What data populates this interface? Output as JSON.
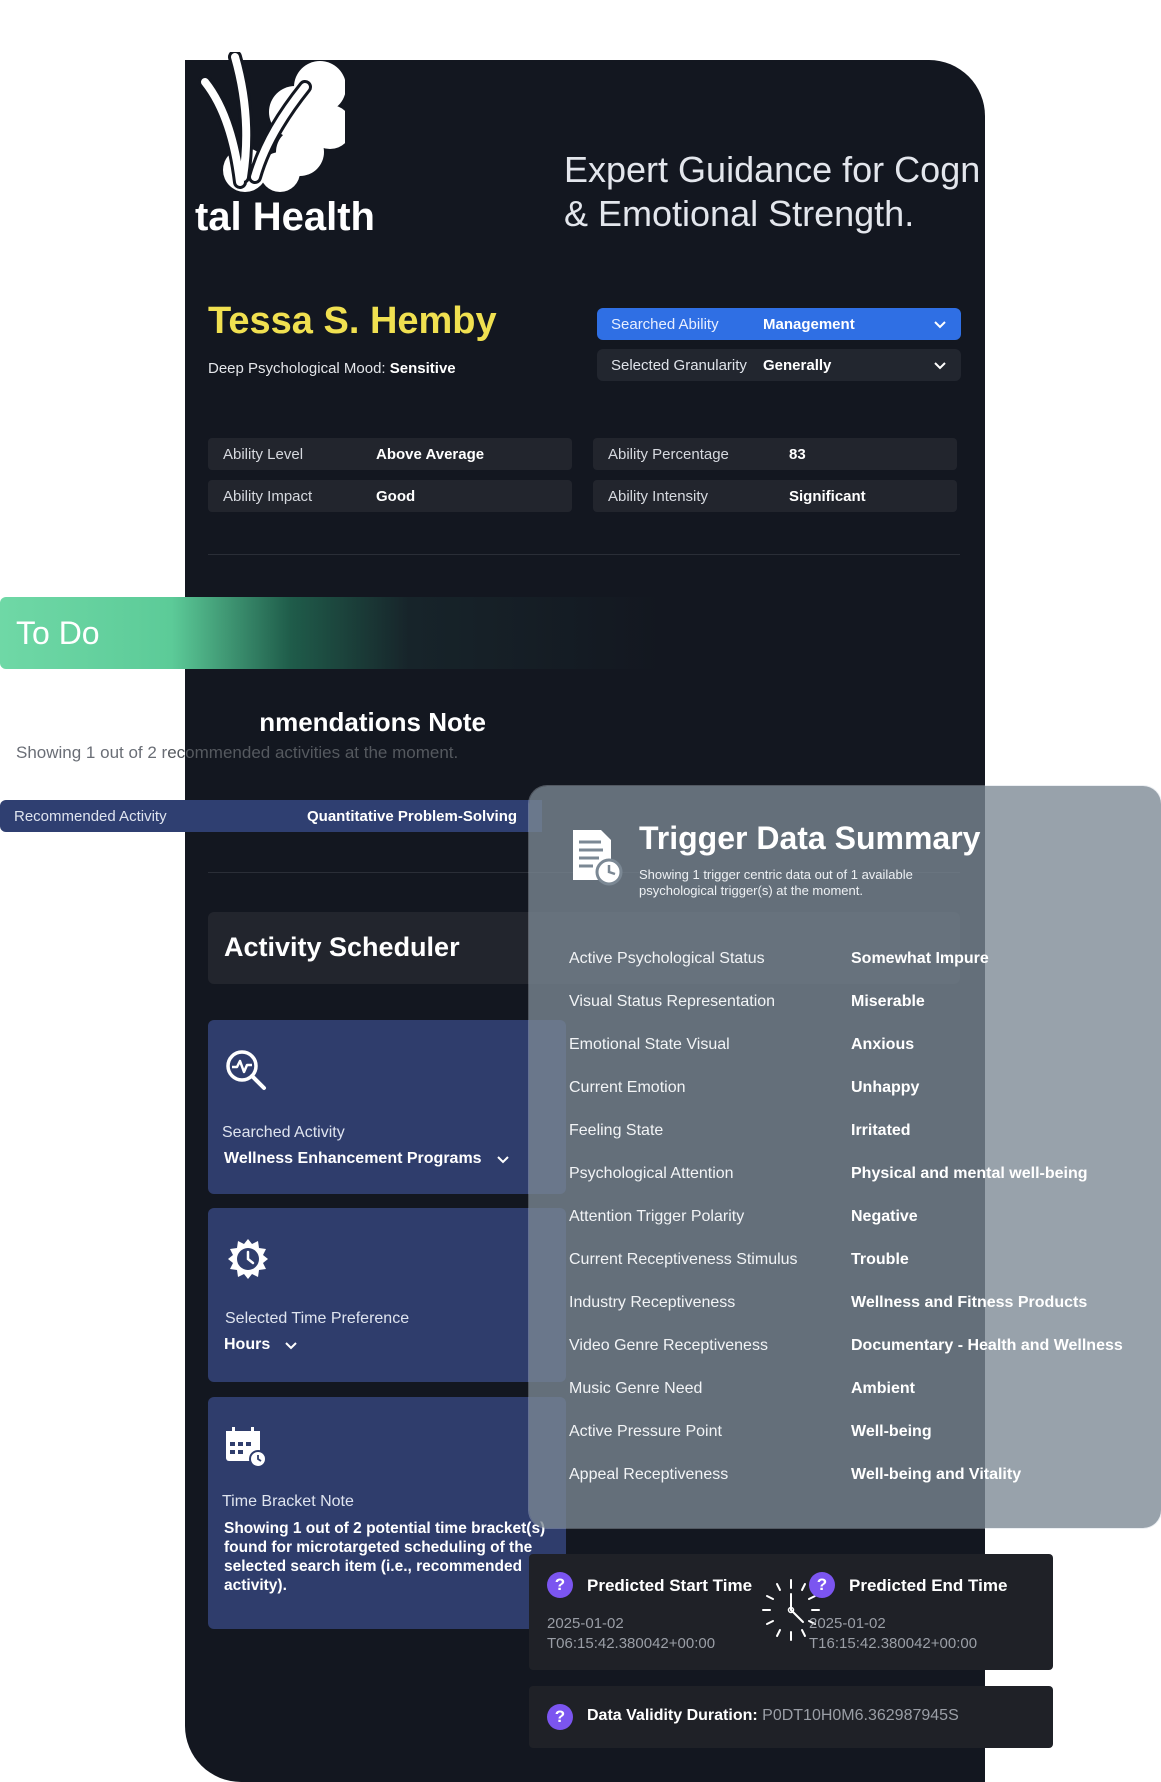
{
  "brand": {
    "name_fragment": "tal Health",
    "tagline_line1": "Expert Guidance for Cogn",
    "tagline_line2": "& Emotional Strength."
  },
  "profile": {
    "name": "Tessa S. Hemby",
    "mood_label": "Deep Psychological Mood:",
    "mood_value": "Sensitive"
  },
  "selectors": {
    "ability": {
      "label": "Searched Ability",
      "value": "Management"
    },
    "granularity": {
      "label": "Selected Granularity",
      "value": "Generally"
    }
  },
  "metrics": {
    "level": {
      "label": "Ability Level",
      "value": "Above Average"
    },
    "percentage": {
      "label": "Ability Percentage",
      "value": "83"
    },
    "impact": {
      "label": "Ability Impact",
      "value": "Good"
    },
    "intensity": {
      "label": "Ability Intensity",
      "value": "Significant"
    }
  },
  "todo": {
    "label": "To Do"
  },
  "recommendations": {
    "title_fragment": "nmendations Note",
    "showing_prefix": "Showing 1 out of 2 r",
    "showing_rest": "ecommended activities at the moment.",
    "activity_label": "Recommended Activity",
    "activity_value": "Quantitative Problem-Solving"
  },
  "scheduler": {
    "title": "Activity Scheduler",
    "searched_activity": {
      "label": "Searched Activity",
      "value": "Wellness Enhancement Programs",
      "icon": "search-activity-icon"
    },
    "time_preference": {
      "label": "Selected Time Preference",
      "value": "Hours",
      "icon": "clock-gear-icon"
    },
    "time_bracket": {
      "label": "Time Bracket Note",
      "note": "Showing 1 out of 2 potential time bracket(s) found for microtargeted scheduling of the selected search item (i.e., recommended activity).",
      "icon": "calendar-clock-icon"
    }
  },
  "trigger": {
    "title": "Trigger Data Summary",
    "subtitle": "Showing 1 trigger centric data out of 1 available psychological trigger(s) at the moment.",
    "rows": [
      {
        "key": "Active Psychological Status",
        "value": "Somewhat Impure"
      },
      {
        "key": "Visual Status Representation",
        "value": "Miserable"
      },
      {
        "key": "Emotional State Visual",
        "value": "Anxious"
      },
      {
        "key": "Current Emotion",
        "value": "Unhappy"
      },
      {
        "key": "Feeling State",
        "value": "Irritated"
      },
      {
        "key": "Psychological Attention",
        "value": "Physical and mental well-being"
      },
      {
        "key": "Attention Trigger Polarity",
        "value": "Negative"
      },
      {
        "key": "Current Receptiveness Stimulus",
        "value": "Trouble"
      },
      {
        "key": "Industry Receptiveness",
        "value": "Wellness and Fitness Products"
      },
      {
        "key": "Video Genre Receptiveness",
        "value": "Documentary - Health and Wellness"
      },
      {
        "key": "Music Genre Need",
        "value": "Ambient"
      },
      {
        "key": "Active Pressure Point",
        "value": "Well-being"
      },
      {
        "key": "Appeal Receptiveness",
        "value": "Well-being and Vitality"
      }
    ]
  },
  "prediction": {
    "start": {
      "label": "Predicted Start Time",
      "date": "2025-01-02",
      "time": "T06:15:42.380042+00:00"
    },
    "end": {
      "label": "Predicted End Time",
      "date": "2025-01-02",
      "time": "T16:15:42.380042+00:00"
    },
    "help_glyph": "?"
  },
  "validity": {
    "label": "Data Validity Duration:",
    "value": "P0DT10H0M6.362987945S"
  },
  "colors": {
    "card_bg": "#131720",
    "accent_blue": "#2f6fe4",
    "name_yellow": "#f0e050",
    "todo_green": "#6fd8a6",
    "card_blue": "#2f3d6c",
    "help_purple": "#7b55f0"
  }
}
